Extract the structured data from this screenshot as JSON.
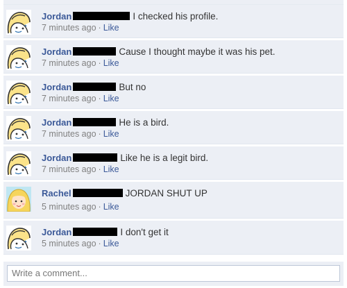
{
  "comments": [
    {
      "author": "Jordan",
      "text": "I checked his profile.",
      "time": "7 minutes ago",
      "like": "Like",
      "avatar": "jordan"
    },
    {
      "author": "Jordan",
      "text": "Cause I thought maybe it was his pet.",
      "time": "7 minutes ago",
      "like": "Like",
      "avatar": "jordan"
    },
    {
      "author": "Jordan",
      "text": "But no",
      "time": "7 minutes ago",
      "like": "Like",
      "avatar": "jordan"
    },
    {
      "author": "Jordan",
      "text": "He is a bird.",
      "time": "7 minutes ago",
      "like": "Like",
      "avatar": "jordan"
    },
    {
      "author": "Jordan",
      "text": "Like he is a legit bird.",
      "time": "7 minutes ago",
      "like": "Like",
      "avatar": "jordan"
    },
    {
      "author": "Rachel",
      "text": "JORDAN SHUT UP",
      "time": "5 minutes ago",
      "like": "Like",
      "avatar": "rachel"
    },
    {
      "author": "Jordan",
      "text": "I don't get it",
      "time": "5 minutes ago",
      "like": "Like",
      "avatar": "jordan"
    }
  ],
  "separator": "·",
  "composer": {
    "placeholder": "Write a comment..."
  },
  "colors": {
    "link": "#3b5998",
    "row_bg": "#eceff5",
    "redaction": "#000000"
  },
  "icons": {
    "jordan_avatar": "rage-comic-face-icon",
    "rachel_avatar": "blonde-girl-face-icon"
  }
}
